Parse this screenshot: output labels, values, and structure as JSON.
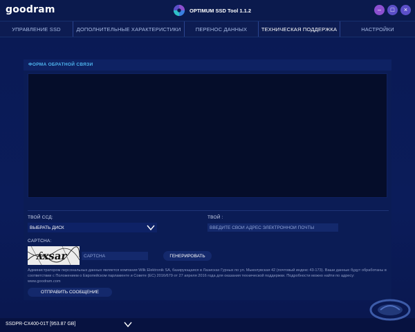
{
  "brand": {
    "logo_text": "goodram"
  },
  "window": {
    "title": "OPTIMUM SSD Tool 1.1.2",
    "buttons": {
      "minimize": "–",
      "maximize": "□",
      "close": "×"
    }
  },
  "nav": {
    "tabs": [
      {
        "label": "УПРАВЛЕНИЕ SSD",
        "active": false
      },
      {
        "label": "ДОПОЛНИТЕЛЬНЫЕ ХАРАКТЕРИСТИКИ",
        "active": false
      },
      {
        "label": "ПЕРЕНОС ДАННЫХ",
        "active": false
      },
      {
        "label": "ТЕХНИЧЕСКАЯ ПОДДЕРЖКА",
        "active": true
      },
      {
        "label": "НАСТРОЙКИ",
        "active": false
      }
    ]
  },
  "form": {
    "title": "ФОРМА ОБРАТНОЙ СВЯЗИ",
    "message_value": "",
    "ssd_label": "ТВОЙ ССД:",
    "ssd_select_value": "ВЫБРАТЬ ДИСК",
    "email_label": "ТВОЙ :",
    "email_placeholder": "ВВЕДИТЕ СВОЙ АДРЕС ЭЛЕКТРОННОЙ ПОЧТЫ",
    "captcha_label": "CAPTCHA:",
    "captcha_image_text": "ʎxsar",
    "captcha_placeholder": "CAPTCHA",
    "generate_button": "ГЕНЕРИРОВАТЬ",
    "privacy_text": "Администратором персональных данных является компания Wilk Elektronik SA, базирующаяся в Лаэисках Гурных по ул. Мыколувская 42 (почтовый индекс 43-173). Ваши данные будут обработаны в соответствии с Положением о Европейском парламенте и Совете (ЕС) 2016/679 от 27 апреля 2016 года для оказания технической поддержки. Подробности можно найти по адресу: www.goodram.com",
    "send_button": "ОТПРАВИТЬ СООБЩЕНИЕ"
  },
  "status": {
    "drive": "SSDPR-CX400-01T [953.87 GB]"
  },
  "colors": {
    "accent": "#4fb6f0",
    "background": "#0a1a52",
    "button": "#14296c"
  }
}
